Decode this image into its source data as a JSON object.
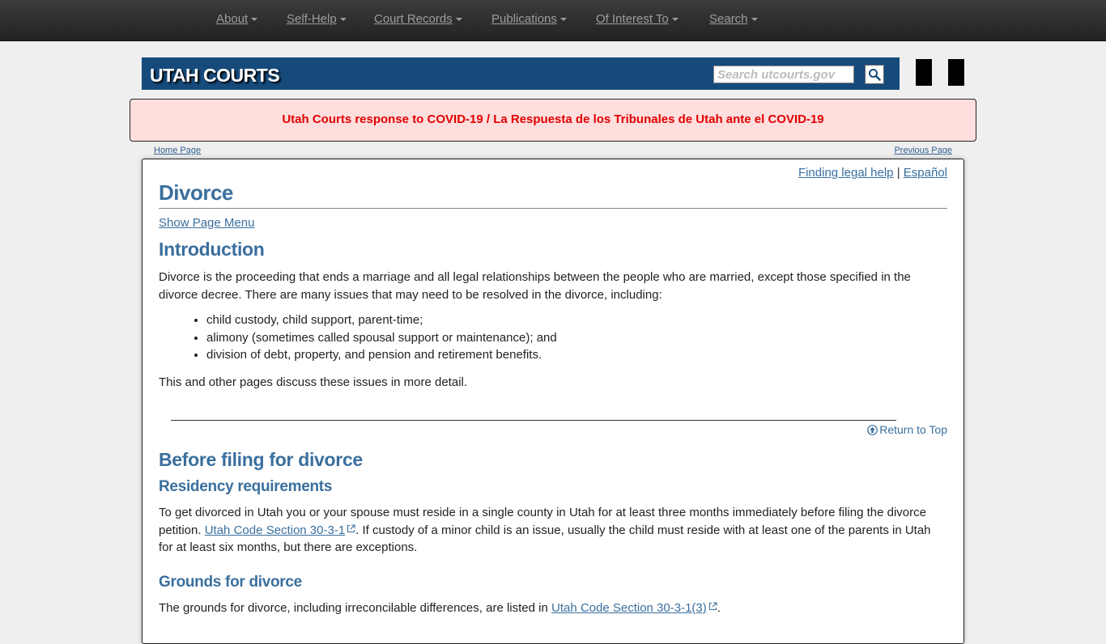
{
  "nav": {
    "items": [
      {
        "label": "About"
      },
      {
        "label": "Self-Help"
      },
      {
        "label": "Court Records"
      },
      {
        "label": "Publications"
      },
      {
        "label": "Of Interest To"
      },
      {
        "label": "Search"
      }
    ]
  },
  "header": {
    "logo": "UTAH COURTS",
    "search_placeholder": "Search utcourts.gov",
    "search_icon": "magnifier-icon"
  },
  "alert": {
    "text": "Utah Courts response to COVID-19 / La Respuesta de los Tribunales de Utah ante el COVID-19",
    "color": "#e10000"
  },
  "breadcrumbs": {
    "home": "Home Page",
    "previous": "Previous Page"
  },
  "content": {
    "finding_help": "Finding legal help",
    "separator": "|",
    "espanol": "Español",
    "title": "Divorce",
    "show_menu": "Show Page Menu",
    "intro": {
      "heading": "Introduction",
      "p1": "Divorce is the proceeding that ends a marriage and all legal relationships between the people who are married, except those specified in the divorce decree. There are many issues that may need to be resolved in the divorce, including:",
      "bullets": [
        "child custody, child support, parent-time;",
        "alimony (sometimes called spousal support or maintenance); and",
        "division of debt, property, and pension and retirement benefits."
      ],
      "p2": "This and other pages discuss these issues in more detail."
    },
    "return_top": "Return to Top",
    "before": {
      "heading": "Before filing for divorce",
      "residency": {
        "heading": "Residency requirements",
        "text_a": "To get divorced in Utah you or your spouse must reside in a single county in Utah for at least three months immediately before filing the divorce petition. ",
        "link": "Utah Code Section 30-3-1",
        "text_b": ". If custody of a minor child is an issue, usually the child must reside with at least one of the parents in Utah for at least six months, but there are exceptions."
      },
      "grounds": {
        "heading": "Grounds for divorce",
        "text_a": "The grounds for divorce, including irreconcilable differences, are listed in ",
        "link": "Utah Code Section 30-3-1(3)",
        "text_b": "."
      }
    }
  },
  "colors": {
    "banner": "#164a7b",
    "heading": "#3a6f9e",
    "alert_bg": "#ffdede"
  }
}
